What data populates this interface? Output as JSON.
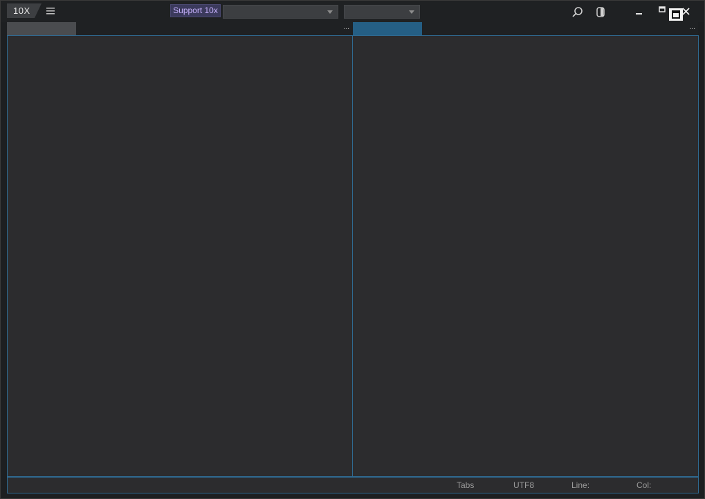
{
  "app": {
    "logo_text": "10X"
  },
  "titlebar": {
    "support_label": "Support 10x",
    "dropdown_1_value": "",
    "dropdown_2_value": ""
  },
  "icons": {
    "menu": "hamburger-menu-icon",
    "search": "search-icon",
    "panel": "panel-toggle-icon",
    "minimize": "minimize-icon",
    "maximize": "maximize-icon",
    "restore": "restore-icon",
    "close": "close-icon"
  },
  "tabs": {
    "left_more": "...",
    "right_more": "..."
  },
  "statusbar": {
    "indent_mode": "Tabs",
    "encoding": "UTF8",
    "line_label": "Line:",
    "col_label": "Col:"
  },
  "colors": {
    "accent": "#2f6a91",
    "active_tab": "#255f85",
    "inactive_tab": "#4a4c4f",
    "support_bg": "#3b3a5c",
    "support_text": "#c9b3ff",
    "editor_bg": "#2c2c2e"
  }
}
